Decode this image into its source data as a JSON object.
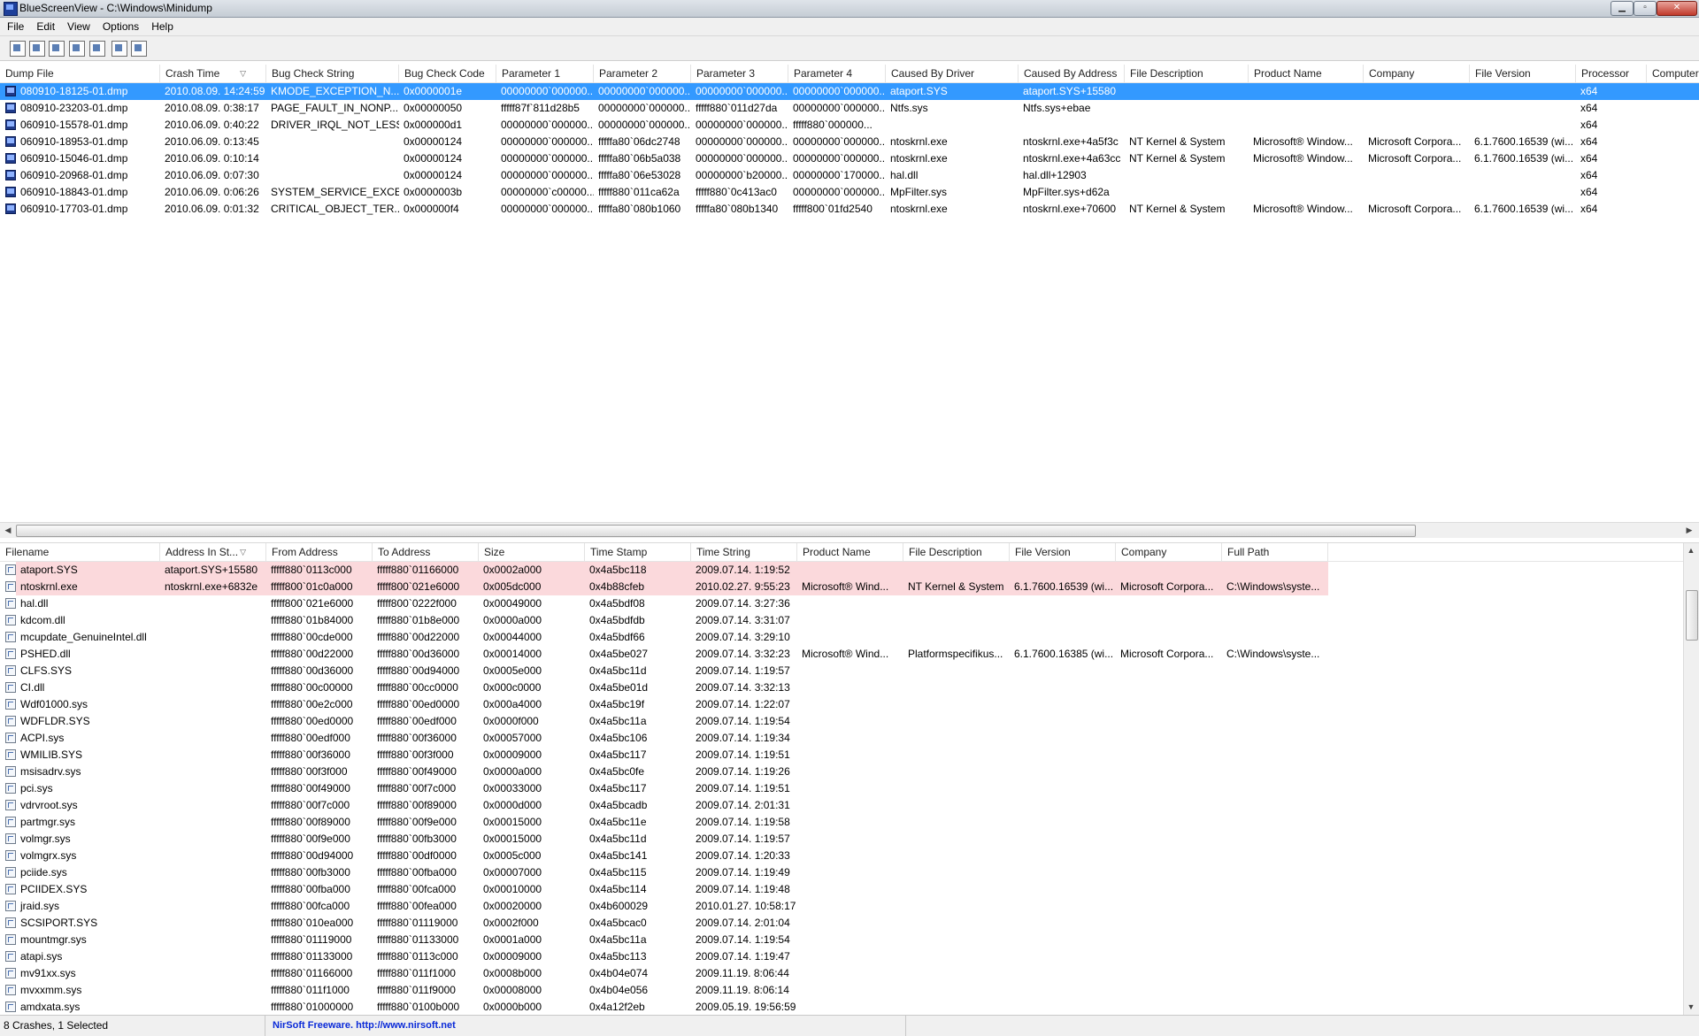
{
  "window": {
    "title": "BlueScreenView  -  C:\\Windows\\Minidump"
  },
  "menu": [
    "File",
    "Edit",
    "View",
    "Options",
    "Help"
  ],
  "toolbar_icons": [
    "properties-icon",
    "save-icon",
    "refresh-icon",
    "copy-icon",
    "html-report-icon",
    "find-icon",
    "exit-icon"
  ],
  "crash_list": {
    "columns": [
      "Dump File",
      "Crash Time",
      "Bug Check String",
      "Bug Check Code",
      "Parameter 1",
      "Parameter 2",
      "Parameter 3",
      "Parameter 4",
      "Caused By Driver",
      "Caused By Address",
      "File Description",
      "Product Name",
      "Company",
      "File Version",
      "Processor",
      "Computer"
    ],
    "sort_column": "Crash Time",
    "rows": [
      [
        "080910-18125-01.dmp",
        "2010.08.09. 14:24:59",
        "KMODE_EXCEPTION_N...",
        "0x0000001e",
        "00000000`000000...",
        "00000000`000000...",
        "00000000`000000...",
        "00000000`000000...",
        "ataport.SYS",
        "ataport.SYS+15580",
        "",
        "",
        "",
        "",
        "x64",
        ""
      ],
      [
        "080910-23203-01.dmp",
        "2010.08.09. 0:38:17",
        "PAGE_FAULT_IN_NONP...",
        "0x00000050",
        "fffff87f`811d28b5",
        "00000000`000000...",
        "fffff880`011d27da",
        "00000000`000000...",
        "Ntfs.sys",
        "Ntfs.sys+ebae",
        "",
        "",
        "",
        "",
        "x64",
        ""
      ],
      [
        "060910-15578-01.dmp",
        "2010.06.09. 0:40:22",
        "DRIVER_IRQL_NOT_LESS...",
        "0x000000d1",
        "00000000`000000...",
        "00000000`000000...",
        "00000000`000000...",
        "fffff880`000000...",
        "",
        "",
        "",
        "",
        "",
        "",
        "x64",
        ""
      ],
      [
        "060910-18953-01.dmp",
        "2010.06.09. 0:13:45",
        "",
        "0x00000124",
        "00000000`000000...",
        "fffffa80`06dc2748",
        "00000000`000000...",
        "00000000`000000...",
        "ntoskrnl.exe",
        "ntoskrnl.exe+4a5f3c",
        "NT Kernel & System",
        "Microsoft® Window...",
        "Microsoft Corpora...",
        "6.1.7600.16539 (wi...",
        "x64",
        ""
      ],
      [
        "060910-15046-01.dmp",
        "2010.06.09. 0:10:14",
        "",
        "0x00000124",
        "00000000`000000...",
        "fffffa80`06b5a038",
        "00000000`000000...",
        "00000000`000000...",
        "ntoskrnl.exe",
        "ntoskrnl.exe+4a63cc",
        "NT Kernel & System",
        "Microsoft® Window...",
        "Microsoft Corpora...",
        "6.1.7600.16539 (wi...",
        "x64",
        ""
      ],
      [
        "060910-20968-01.dmp",
        "2010.06.09. 0:07:30",
        "",
        "0x00000124",
        "00000000`000000...",
        "fffffa80`06e53028",
        "00000000`b20000...",
        "00000000`170000...",
        "hal.dll",
        "hal.dll+12903",
        "",
        "",
        "",
        "",
        "x64",
        ""
      ],
      [
        "060910-18843-01.dmp",
        "2010.06.09. 0:06:26",
        "SYSTEM_SERVICE_EXCE...",
        "0x0000003b",
        "00000000`c00000...",
        "fffff880`011ca62a",
        "fffff880`0c413ac0",
        "00000000`000000...",
        "MpFilter.sys",
        "MpFilter.sys+d62a",
        "",
        "",
        "",
        "",
        "x64",
        ""
      ],
      [
        "060910-17703-01.dmp",
        "2010.06.09. 0:01:32",
        "CRITICAL_OBJECT_TER...",
        "0x000000f4",
        "00000000`000000...",
        "fffffa80`080b1060",
        "fffffa80`080b1340",
        "fffff800`01fd2540",
        "ntoskrnl.exe",
        "ntoskrnl.exe+70600",
        "NT Kernel & System",
        "Microsoft® Window...",
        "Microsoft Corpora...",
        "6.1.7600.16539 (wi...",
        "x64",
        ""
      ]
    ]
  },
  "driver_list": {
    "columns": [
      "Filename",
      "Address In St...",
      "From Address",
      "To Address",
      "Size",
      "Time Stamp",
      "Time String",
      "Product Name",
      "File Description",
      "File Version",
      "Company",
      "Full Path"
    ],
    "sort_column": "Address In St...",
    "rows": [
      [
        "ataport.SYS",
        "ataport.SYS+15580",
        "fffff880`0113c000",
        "fffff880`01166000",
        "0x0002a000",
        "0x4a5bc118",
        "2009.07.14. 1:19:52",
        "",
        "",
        "",
        "",
        ""
      ],
      [
        "ntoskrnl.exe",
        "ntoskrnl.exe+6832e",
        "fffff800`01c0a000",
        "fffff800`021e6000",
        "0x005dc000",
        "0x4b88cfeb",
        "2010.02.27. 9:55:23",
        "Microsoft® Wind...",
        "NT Kernel & System",
        "6.1.7600.16539 (wi...",
        "Microsoft Corpora...",
        "C:\\Windows\\syste..."
      ],
      [
        "hal.dll",
        "",
        "fffff800`021e6000",
        "fffff800`0222f000",
        "0x00049000",
        "0x4a5bdf08",
        "2009.07.14. 3:27:36",
        "",
        "",
        "",
        "",
        ""
      ],
      [
        "kdcom.dll",
        "",
        "fffff880`01b84000",
        "fffff880`01b8e000",
        "0x0000a000",
        "0x4a5bdfdb",
        "2009.07.14. 3:31:07",
        "",
        "",
        "",
        "",
        ""
      ],
      [
        "mcupdate_GenuineIntel.dll",
        "",
        "fffff880`00cde000",
        "fffff880`00d22000",
        "0x00044000",
        "0x4a5bdf66",
        "2009.07.14. 3:29:10",
        "",
        "",
        "",
        "",
        ""
      ],
      [
        "PSHED.dll",
        "",
        "fffff880`00d22000",
        "fffff880`00d36000",
        "0x00014000",
        "0x4a5be027",
        "2009.07.14. 3:32:23",
        "Microsoft® Wind...",
        "Platformspecifikus...",
        "6.1.7600.16385 (wi...",
        "Microsoft Corpora...",
        "C:\\Windows\\syste..."
      ],
      [
        "CLFS.SYS",
        "",
        "fffff880`00d36000",
        "fffff880`00d94000",
        "0x0005e000",
        "0x4a5bc11d",
        "2009.07.14. 1:19:57",
        "",
        "",
        "",
        "",
        ""
      ],
      [
        "CI.dll",
        "",
        "fffff880`00c00000",
        "fffff880`00cc0000",
        "0x000c0000",
        "0x4a5be01d",
        "2009.07.14. 3:32:13",
        "",
        "",
        "",
        "",
        ""
      ],
      [
        "Wdf01000.sys",
        "",
        "fffff880`00e2c000",
        "fffff880`00ed0000",
        "0x000a4000",
        "0x4a5bc19f",
        "2009.07.14. 1:22:07",
        "",
        "",
        "",
        "",
        ""
      ],
      [
        "WDFLDR.SYS",
        "",
        "fffff880`00ed0000",
        "fffff880`00edf000",
        "0x0000f000",
        "0x4a5bc11a",
        "2009.07.14. 1:19:54",
        "",
        "",
        "",
        "",
        ""
      ],
      [
        "ACPI.sys",
        "",
        "fffff880`00edf000",
        "fffff880`00f36000",
        "0x00057000",
        "0x4a5bc106",
        "2009.07.14. 1:19:34",
        "",
        "",
        "",
        "",
        ""
      ],
      [
        "WMILIB.SYS",
        "",
        "fffff880`00f36000",
        "fffff880`00f3f000",
        "0x00009000",
        "0x4a5bc117",
        "2009.07.14. 1:19:51",
        "",
        "",
        "",
        "",
        ""
      ],
      [
        "msisadrv.sys",
        "",
        "fffff880`00f3f000",
        "fffff880`00f49000",
        "0x0000a000",
        "0x4a5bc0fe",
        "2009.07.14. 1:19:26",
        "",
        "",
        "",
        "",
        ""
      ],
      [
        "pci.sys",
        "",
        "fffff880`00f49000",
        "fffff880`00f7c000",
        "0x00033000",
        "0x4a5bc117",
        "2009.07.14. 1:19:51",
        "",
        "",
        "",
        "",
        ""
      ],
      [
        "vdrvroot.sys",
        "",
        "fffff880`00f7c000",
        "fffff880`00f89000",
        "0x0000d000",
        "0x4a5bcadb",
        "2009.07.14. 2:01:31",
        "",
        "",
        "",
        "",
        ""
      ],
      [
        "partmgr.sys",
        "",
        "fffff880`00f89000",
        "fffff880`00f9e000",
        "0x00015000",
        "0x4a5bc11e",
        "2009.07.14. 1:19:58",
        "",
        "",
        "",
        "",
        ""
      ],
      [
        "volmgr.sys",
        "",
        "fffff880`00f9e000",
        "fffff880`00fb3000",
        "0x00015000",
        "0x4a5bc11d",
        "2009.07.14. 1:19:57",
        "",
        "",
        "",
        "",
        ""
      ],
      [
        "volmgrx.sys",
        "",
        "fffff880`00d94000",
        "fffff880`00df0000",
        "0x0005c000",
        "0x4a5bc141",
        "2009.07.14. 1:20:33",
        "",
        "",
        "",
        "",
        ""
      ],
      [
        "pciide.sys",
        "",
        "fffff880`00fb3000",
        "fffff880`00fba000",
        "0x00007000",
        "0x4a5bc115",
        "2009.07.14. 1:19:49",
        "",
        "",
        "",
        "",
        ""
      ],
      [
        "PCIIDEX.SYS",
        "",
        "fffff880`00fba000",
        "fffff880`00fca000",
        "0x00010000",
        "0x4a5bc114",
        "2009.07.14. 1:19:48",
        "",
        "",
        "",
        "",
        ""
      ],
      [
        "jraid.sys",
        "",
        "fffff880`00fca000",
        "fffff880`00fea000",
        "0x00020000",
        "0x4b600029",
        "2010.01.27. 10:58:17",
        "",
        "",
        "",
        "",
        ""
      ],
      [
        "SCSIPORT.SYS",
        "",
        "fffff880`010ea000",
        "fffff880`01119000",
        "0x0002f000",
        "0x4a5bcac0",
        "2009.07.14. 2:01:04",
        "",
        "",
        "",
        "",
        ""
      ],
      [
        "mountmgr.sys",
        "",
        "fffff880`01119000",
        "fffff880`01133000",
        "0x0001a000",
        "0x4a5bc11a",
        "2009.07.14. 1:19:54",
        "",
        "",
        "",
        "",
        ""
      ],
      [
        "atapi.sys",
        "",
        "fffff880`01133000",
        "fffff880`0113c000",
        "0x00009000",
        "0x4a5bc113",
        "2009.07.14. 1:19:47",
        "",
        "",
        "",
        "",
        ""
      ],
      [
        "mv91xx.sys",
        "",
        "fffff880`01166000",
        "fffff880`011f1000",
        "0x0008b000",
        "0x4b04e074",
        "2009.11.19. 8:06:44",
        "",
        "",
        "",
        "",
        ""
      ],
      [
        "mvxxmm.sys",
        "",
        "fffff880`011f1000",
        "fffff880`011f9000",
        "0x00008000",
        "0x4b04e056",
        "2009.11.19. 8:06:14",
        "",
        "",
        "",
        "",
        ""
      ],
      [
        "amdxata.sys",
        "",
        "fffff880`01000000",
        "fffff880`0100b000",
        "0x0000b000",
        "0x4a12f2eb",
        "2009.05.19. 19:56:59",
        "",
        "",
        "",
        "",
        ""
      ]
    ]
  },
  "status": {
    "count_text": "8 Crashes, 1 Selected",
    "freeware_text": "NirSoft Freeware.  http://www.nirsoft.net"
  }
}
